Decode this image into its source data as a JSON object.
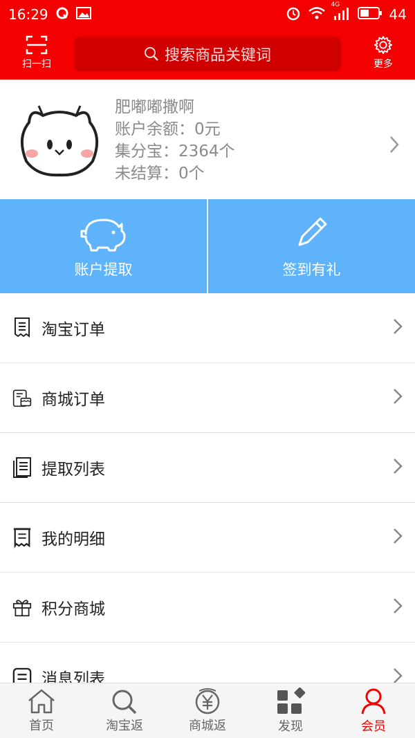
{
  "status": {
    "time": "16:29",
    "network": "4G",
    "battery": "44"
  },
  "topbar": {
    "scan_label": "扫一扫",
    "search_placeholder": "搜索商品关键词",
    "more_label": "更多"
  },
  "profile": {
    "name": "肥嘟嘟撒啊",
    "balance": "账户余额：0元",
    "points": "集分宝：2364个",
    "pending": "未结算：0个"
  },
  "quick": {
    "withdraw_label": "账户提取",
    "checkin_label": "签到有礼"
  },
  "menu": {
    "items": [
      {
        "label": "淘宝订单"
      },
      {
        "label": "商城订单"
      },
      {
        "label": "提取列表"
      },
      {
        "label": "我的明细"
      },
      {
        "label": "积分商城"
      },
      {
        "label": "消息列表"
      }
    ]
  },
  "tabs": [
    {
      "label": "首页"
    },
    {
      "label": "淘宝返"
    },
    {
      "label": "商城返"
    },
    {
      "label": "发现"
    },
    {
      "label": "会员"
    }
  ],
  "colors": {
    "brand": "#f40000",
    "accent": "#5eb3fb",
    "active_tab": "#f40000"
  }
}
